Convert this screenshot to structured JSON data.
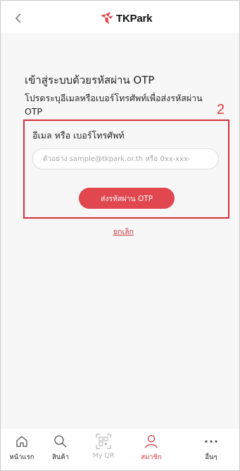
{
  "header": {
    "logo_text": "TKPark"
  },
  "main": {
    "title": "เข้าสู่ระบบด้วยรหัสผ่าน OTP",
    "description": "โปรดระบุอีเมลหรือเบอร์โทรศัพท์เพื่อส่งรหัสผ่าน OTP",
    "step_number": "2",
    "field_label": "อีเมล หรือ เบอร์โทรศัพท์",
    "input_placeholder": "ตัวอย่าง sample@tkpark.or.th หรือ 0xx-xxx-",
    "input_value": "",
    "send_otp_label": "ส่งรหัสผ่าน OTP",
    "cancel_label": "ยกเลิก"
  },
  "tabbar": {
    "items": [
      {
        "label": "หน้าแรก",
        "icon": "home-icon",
        "state": "normal"
      },
      {
        "label": "สินค้า",
        "icon": "search-icon",
        "state": "normal"
      },
      {
        "label": "My QR",
        "icon": "qr-icon",
        "state": "disabled"
      },
      {
        "label": "สมาชิก",
        "icon": "user-icon",
        "state": "active"
      },
      {
        "label": "อื่นๆ",
        "icon": "more-icon",
        "state": "normal"
      }
    ]
  },
  "colors": {
    "accent": "#e0474f",
    "highlight_border": "#d32f3a",
    "content_bg": "#f7f7f7"
  }
}
